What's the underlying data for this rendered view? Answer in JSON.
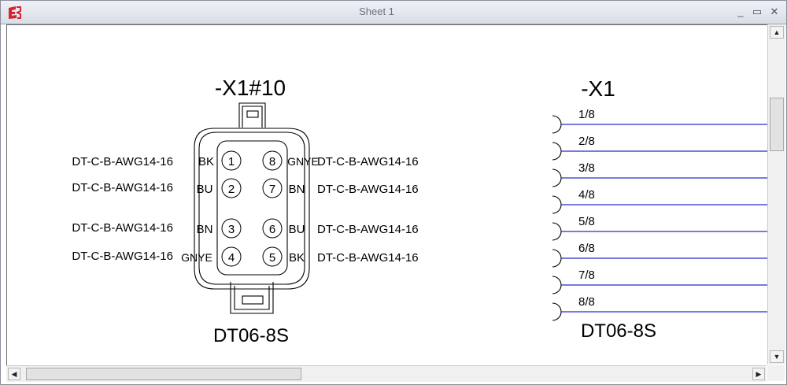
{
  "window": {
    "title": "Sheet 1",
    "app_icon": "e3-logo-icon",
    "controls": {
      "minimize": "_",
      "maximize": "▭",
      "close": "✕"
    }
  },
  "connector_left": {
    "name": "-X1#10",
    "part": "DT06-8S",
    "pins": [
      {
        "num": "1",
        "color": "BK",
        "wire": "DT-C-B-AWG14-16"
      },
      {
        "num": "2",
        "color": "BU",
        "wire": "DT-C-B-AWG14-16"
      },
      {
        "num": "3",
        "color": "BN",
        "wire": "DT-C-B-AWG14-16"
      },
      {
        "num": "4",
        "color": "GNYE",
        "wire": "DT-C-B-AWG14-16"
      },
      {
        "num": "5",
        "color": "BK",
        "wire": "DT-C-B-AWG14-16"
      },
      {
        "num": "6",
        "color": "BU",
        "wire": "DT-C-B-AWG14-16"
      },
      {
        "num": "7",
        "color": "BN",
        "wire": "DT-C-B-AWG14-16"
      },
      {
        "num": "8",
        "color": "GNYE",
        "wire": "DT-C-B-AWG14-16"
      }
    ]
  },
  "connector_right": {
    "name": "-X1",
    "part": "DT06-8S",
    "pins": [
      "1/8",
      "2/8",
      "3/8",
      "4/8",
      "5/8",
      "6/8",
      "7/8",
      "8/8"
    ]
  },
  "colors": {
    "wire_line": "#2b2bc8",
    "ink": "#000000"
  },
  "scrollbars": {
    "up": "▲",
    "down": "▼",
    "left": "◀",
    "right": "▶"
  }
}
